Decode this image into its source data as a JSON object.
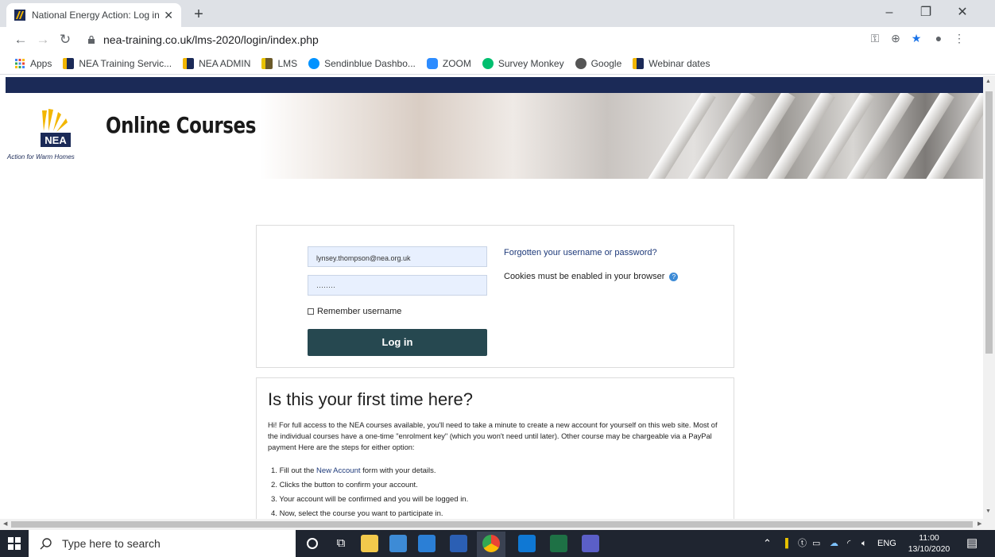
{
  "browser": {
    "tab_title": "National Energy Action: Log in to",
    "tab_close": "✕",
    "new_tab": "+",
    "url": "nea-training.co.uk/lms-2020/login/index.php",
    "bookmarks": [
      {
        "label": "Apps",
        "color": "#4285f4"
      },
      {
        "label": "NEA Training Servic...",
        "color": "#c8a200"
      },
      {
        "label": "NEA ADMIN",
        "color": "#c8a200"
      },
      {
        "label": "LMS",
        "color": "#c8a200"
      },
      {
        "label": "Sendinblue Dashbo...",
        "color": "#0092ff"
      },
      {
        "label": "ZOOM",
        "color": "#2d8cff"
      },
      {
        "label": "Survey Monkey",
        "color": "#00bf6f"
      },
      {
        "label": "Google",
        "color": "#555555"
      },
      {
        "label": "Webinar dates",
        "color": "#c8a200"
      }
    ]
  },
  "header": {
    "brand": "Online Courses",
    "logo_text": "NEA",
    "tagline": "Action for Warm Homes"
  },
  "login": {
    "username_value": "lynsey.thompson@nea.org.uk",
    "password_value": "········",
    "remember_label": "Remember username",
    "login_button": "Log in",
    "forgot_link": "Forgotten your username or password?",
    "cookies_note": "Cookies must be enabled in your browser",
    "info_icon": "?"
  },
  "first_time": {
    "heading": "Is this your first time here?",
    "intro": "Hi! For full access to the NEA courses available, you'll need to take a minute to create a new account for yourself on this web site. Most of the individual courses have a one-time \"enrolment key\" (which you won't need until later). Other course may be chargeable via a PayPal payment Here are the steps for either option:",
    "steps": [
      {
        "num": "1.",
        "pre": "Fill out the ",
        "link": "New Account",
        "post": " form with your details."
      },
      {
        "num": "2.",
        "pre": "Clicks the button to confirm your account.",
        "link": "",
        "post": ""
      },
      {
        "num": "3.",
        "pre": "Your account will be confirmed and you will be logged in.",
        "link": "",
        "post": ""
      },
      {
        "num": "4.",
        "pre": "Now, select the course you want to participate in.",
        "link": "",
        "post": ""
      }
    ]
  },
  "taskbar": {
    "search_placeholder": "Type here to search",
    "lang": "ENG",
    "time": "11:00",
    "date": "13/10/2020"
  }
}
